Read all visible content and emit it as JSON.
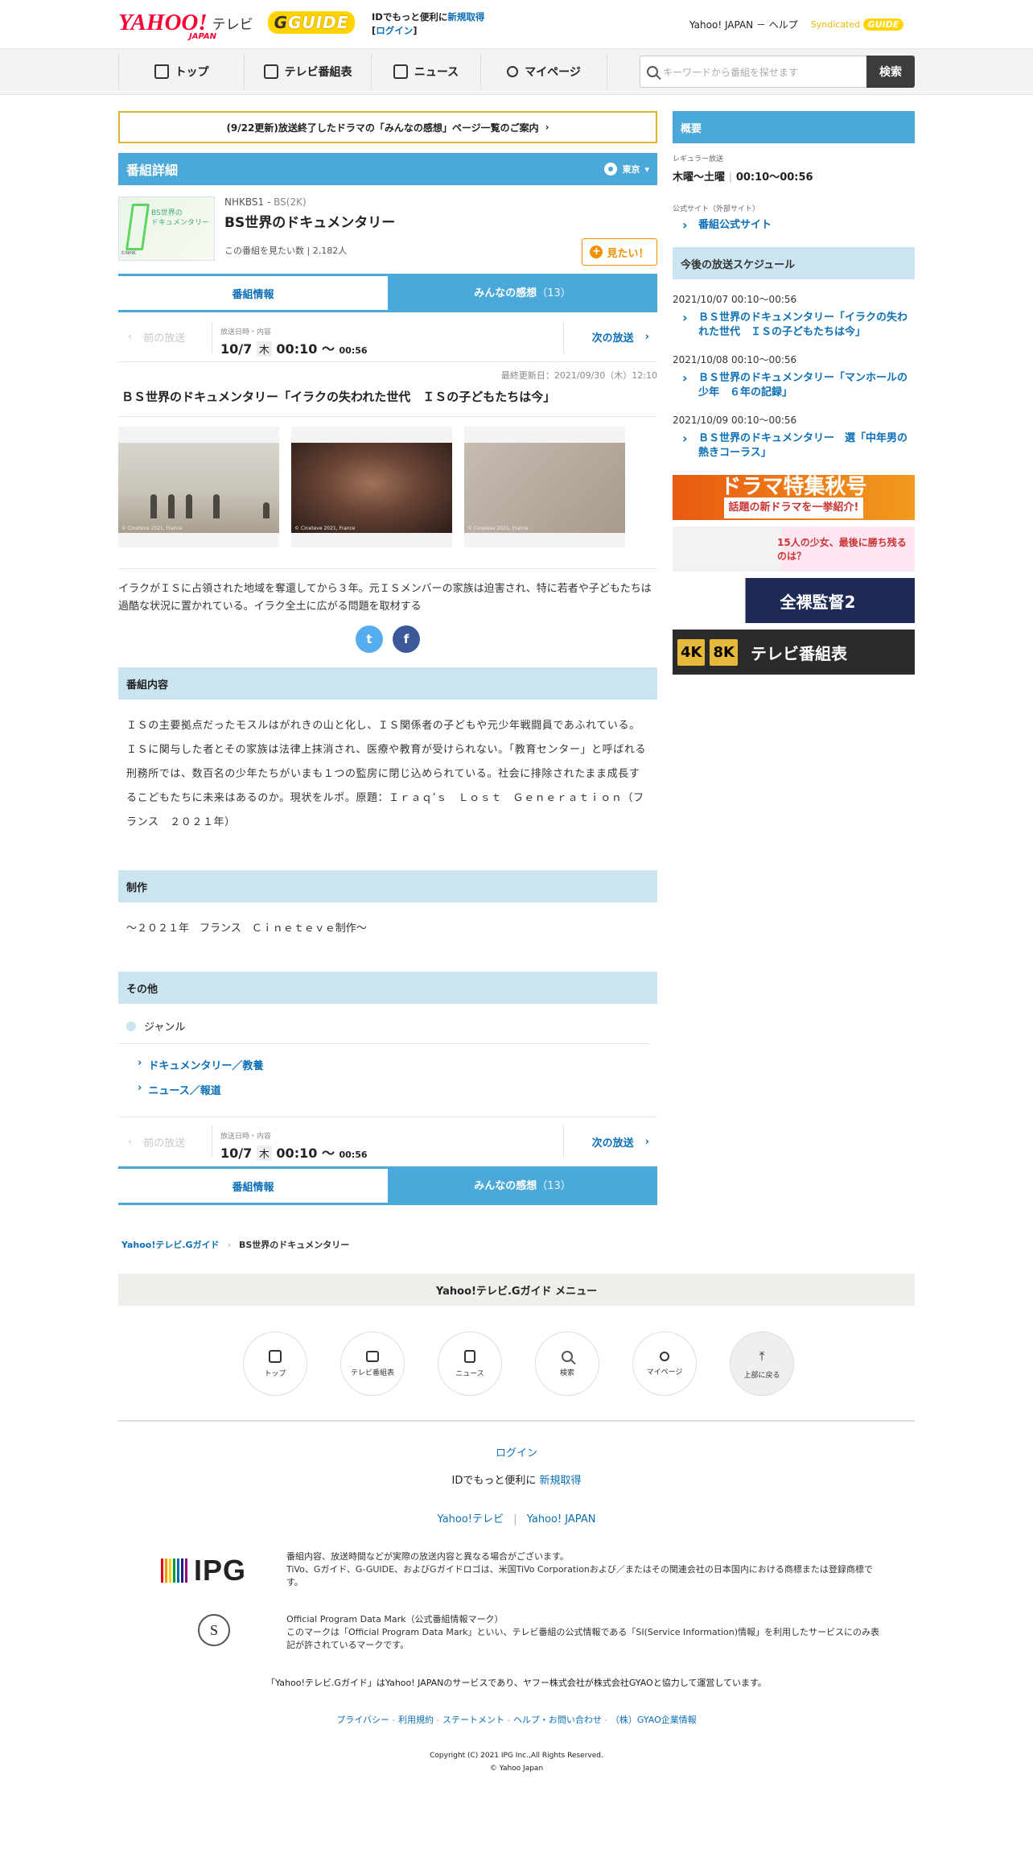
{
  "header": {
    "logo_yahoo": "YAHOO!",
    "logo_japan": "JAPAN",
    "logo_tv": "テレビ",
    "gguide": "G",
    "gguide_rest": "GUIDE",
    "id_text": "IDでもっと便利に",
    "signup": "新規取得",
    "login": "ログイン",
    "yahoo_japan": "Yahoo! JAPAN",
    "help": "ヘルプ",
    "syndicated": "Syndicated",
    "syndicated_logo": "GUIDE"
  },
  "nav": {
    "items": [
      {
        "label": "トップ",
        "icon": "home-icon"
      },
      {
        "label": "テレビ番組表",
        "icon": "tv-icon"
      },
      {
        "label": "ニュース",
        "icon": "news-icon"
      },
      {
        "label": "マイページ",
        "icon": "user-icon"
      }
    ],
    "search_placeholder": "キーワードから番組を探せます",
    "search_button": "検索"
  },
  "notice": "(9/22更新)放送終了したドラマの「みんなの感想」ページ一覧のご案内",
  "detail": {
    "heading": "番組詳細",
    "region": "東京",
    "channel": "NHKBS1",
    "channel_sub": "BS(2K)",
    "thumb_text": "BS世界の\nドキュメンタリー",
    "thumb_credit": "©NHK",
    "title": "BS世界のドキュメンタリー",
    "want_count_label": "この番組を見たい数",
    "want_count": "2,182人",
    "want_button": "見たい！"
  },
  "tabs": {
    "info": "番組情報",
    "reviews": "みんなの感想",
    "reviews_count": "（13）"
  },
  "broadcast": {
    "prev": "前の放送",
    "label": "放送日時・内容",
    "date": "10/7",
    "dow": "木",
    "start": "00:10",
    "sep": "〜",
    "end": "00:56",
    "next": "次の放送"
  },
  "updated": "最終更新日：2021/09/30（木）12:10",
  "episode_title": "ＢＳ世界のドキュメンタリー「イラクの失われた世代　ＩＳの子どもたちは今」",
  "image_captions": [
    "© Cineteve 2021, France",
    "© Cineteve 2021, France",
    "© Cineteve 2021, France"
  ],
  "description": "イラクがＩＳに占領された地域を奪還してから３年。元ＩＳメンバーの家族は迫害され、特に若者や子どもたちは過酷な状況に置かれている。イラク全土に広がる問題を取材する",
  "social": {
    "twitter": "t",
    "facebook": "f"
  },
  "content": {
    "heading": "番組内容",
    "body": "ＩＳの主要拠点だったモスルはがれきの山と化し、ＩＳ関係者の子どもや元少年戦闘員であふれている。ＩＳに関与した者とその家族は法律上抹消され、医療や教育が受けられない。「教育センター」と呼ばれる刑務所では、数百名の少年たちがいまも１つの監房に閉じ込められている。社会に排除されたまま成長するこどもたちに未来はあるのか。現状をルポ。原題：Ｉｒａｑ’ｓ　Ｌｏｓｔ　Ｇｅｎｅｒａｔｉｏｎ（フランス　２０２１年）"
  },
  "production": {
    "heading": "制作",
    "body": "〜２０２１年　フランス　Ｃｉｎｅｔｅｖｅ制作〜"
  },
  "other": {
    "heading": "その他",
    "genre_label": "ジャンル",
    "genres": [
      "ドキュメンタリー／教養",
      "ニュース／報道"
    ]
  },
  "breadcrumb": {
    "root": "Yahoo!テレビ.Gガイド",
    "current": "BS世界のドキュメンタリー"
  },
  "sidebar": {
    "summary": "概要",
    "regular_label": "レギュラー放送",
    "regular_days": "木曜～土曜",
    "regular_time": "00:10～00:56",
    "official_label": "公式サイト（外部サイト）",
    "official_link": "番組公式サイト",
    "schedule_heading": "今後の放送スケジュール",
    "schedule": [
      {
        "date": "2021/10/07 00:10～00:56",
        "title": "ＢＳ世界のドキュメンタリー「イラクの失われた世代　ＩＳの子どもたちは今」"
      },
      {
        "date": "2021/10/08 00:10～00:56",
        "title": "ＢＳ世界のドキュメンタリー「マンホールの少年　６年の記録」"
      },
      {
        "date": "2021/10/09 00:10～00:56",
        "title": "ＢＳ世界のドキュメンタリー　選「中年男の熱きコーラス」"
      }
    ],
    "banners": {
      "b1_title": "ドラマ特集秋号",
      "b1_sub": "話題の新ドラマを一挙紹介!",
      "b2": "15人の少女、最後に勝ち残るのは？",
      "b3": "全裸監督2",
      "b4_4k": "4K",
      "b4_8k": "8K",
      "b4_text": "テレビ番組表"
    }
  },
  "footer": {
    "menu_title": "Yahoo!テレビ.Gガイド メニュー",
    "icons": [
      "トップ",
      "テレビ番組表",
      "ニュース",
      "検索",
      "マイページ",
      "上部に戻る"
    ],
    "login": "ログイン",
    "id_text": "IDでもっと便利に",
    "signup": "新規取得",
    "yahoo_tv": "Yahoo!テレビ",
    "yahoo_japan": "Yahoo! JAPAN",
    "ipg": "IPG",
    "disclaimer1": "番組内容、放送時間などが実際の放送内容と異なる場合がございます。",
    "disclaimer2": "TiVo、Gガイド、G-GUIDE、およびGガイドロゴは、米国TiVo Corporationおよび／またはその関連会社の日本国内における商標または登録商標です。",
    "opdm_title": "Official Program Data Mark（公式番組情報マーク）",
    "opdm_text": "このマークは「Official Program Data Mark」といい、テレビ番組の公式情報である「SI(Service Information)情報」を利用したサービスにのみ表記が許されているマークです。",
    "service_note": "「Yahoo!テレビ.Gガイド」はYahoo! JAPANのサービスであり、ヤフー株式会社が株式会社GYAOと協力して運営しています。",
    "links": [
      "プライバシー",
      "利用規約",
      "ステートメント",
      "ヘルプ・お問い合わせ",
      "（株）GYAO企業情報"
    ],
    "copyright": "Copyright (C) 2021 IPG Inc.,All Rights Reserved.",
    "copyright2": "© Yahoo Japan"
  }
}
